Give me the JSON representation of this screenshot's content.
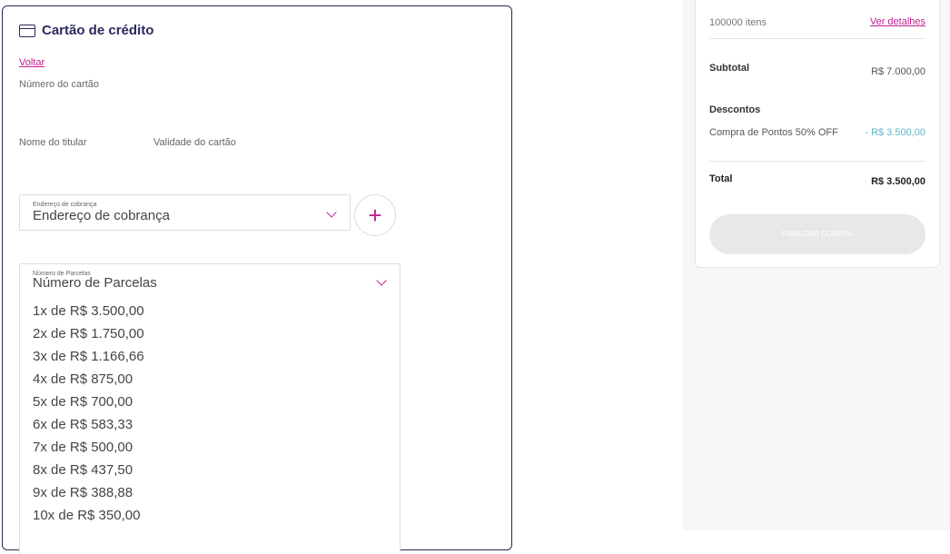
{
  "payment": {
    "title": "Cartão de crédito",
    "back_label": "Voltar",
    "card_number_label": "Número do cartão",
    "holder_label": "Nome do titular",
    "validity_label": "Validade do cartão",
    "address_select": {
      "floating_label": "Endereço de cobrança",
      "value": "Endereço de cobrança"
    },
    "add_button": "+",
    "installments_select": {
      "floating_label": "Número de Parcelas",
      "value": "Número de Parcelas",
      "options": [
        "1x de R$ 3.500,00",
        "2x de R$ 1.750,00",
        "3x de R$ 1.166,66",
        "4x de R$ 875,00",
        "5x de R$ 700,00",
        "6x de R$ 583,33",
        "7x de R$ 500,00",
        "8x de R$ 437,50",
        "9x de R$ 388,88",
        "10x de R$ 350,00"
      ]
    }
  },
  "summary": {
    "items_count": "100000 itens",
    "details_link": "Ver detalhes",
    "subtotal_label": "Subtotal",
    "subtotal_value": "R$ 7.000,00",
    "discounts_label": "Descontos",
    "discount_name": "Compra de Pontos 50% OFF",
    "discount_value": "- R$ 3.500,00",
    "total_label": "Total",
    "total_value": "R$ 3.500,00",
    "finalize_button": "FINALIZAR COMPRA"
  },
  "colors": {
    "accent": "#c2208f",
    "title": "#2b2a5e",
    "discount": "#5fb6c7"
  }
}
